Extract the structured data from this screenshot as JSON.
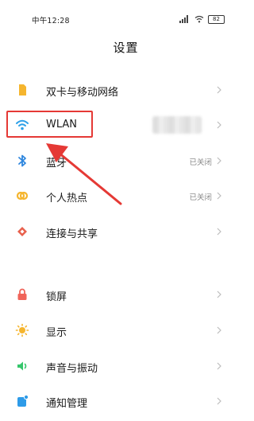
{
  "status_bar": {
    "time": "中午12:28",
    "battery": "82"
  },
  "header": {
    "title": "设置"
  },
  "settings": {
    "items": [
      {
        "label": "双卡与移动网络",
        "value": "",
        "icon": "sim-card-icon",
        "color": "#F5B52E"
      },
      {
        "label": "WLAN",
        "value": "",
        "icon": "wifi-icon",
        "color": "#2DA0E8"
      },
      {
        "label": "蓝牙",
        "value": "已关闭",
        "icon": "bluetooth-icon",
        "color": "#2E86DE"
      },
      {
        "label": "个人热点",
        "value": "已关闭",
        "icon": "hotspot-icon",
        "color": "#F5B52E"
      },
      {
        "label": "连接与共享",
        "value": "",
        "icon": "connection-share-icon",
        "color": "#E8604C"
      },
      {
        "label": "锁屏",
        "value": "",
        "icon": "lock-icon",
        "color": "#F0645A"
      },
      {
        "label": "显示",
        "value": "",
        "icon": "display-icon",
        "color": "#F5B52E"
      },
      {
        "label": "声音与振动",
        "value": "",
        "icon": "sound-icon",
        "color": "#35C66B"
      },
      {
        "label": "通知管理",
        "value": "",
        "icon": "notification-icon",
        "color": "#2E9BE8"
      }
    ]
  },
  "annotation": {
    "highlight_color": "#E53935"
  }
}
